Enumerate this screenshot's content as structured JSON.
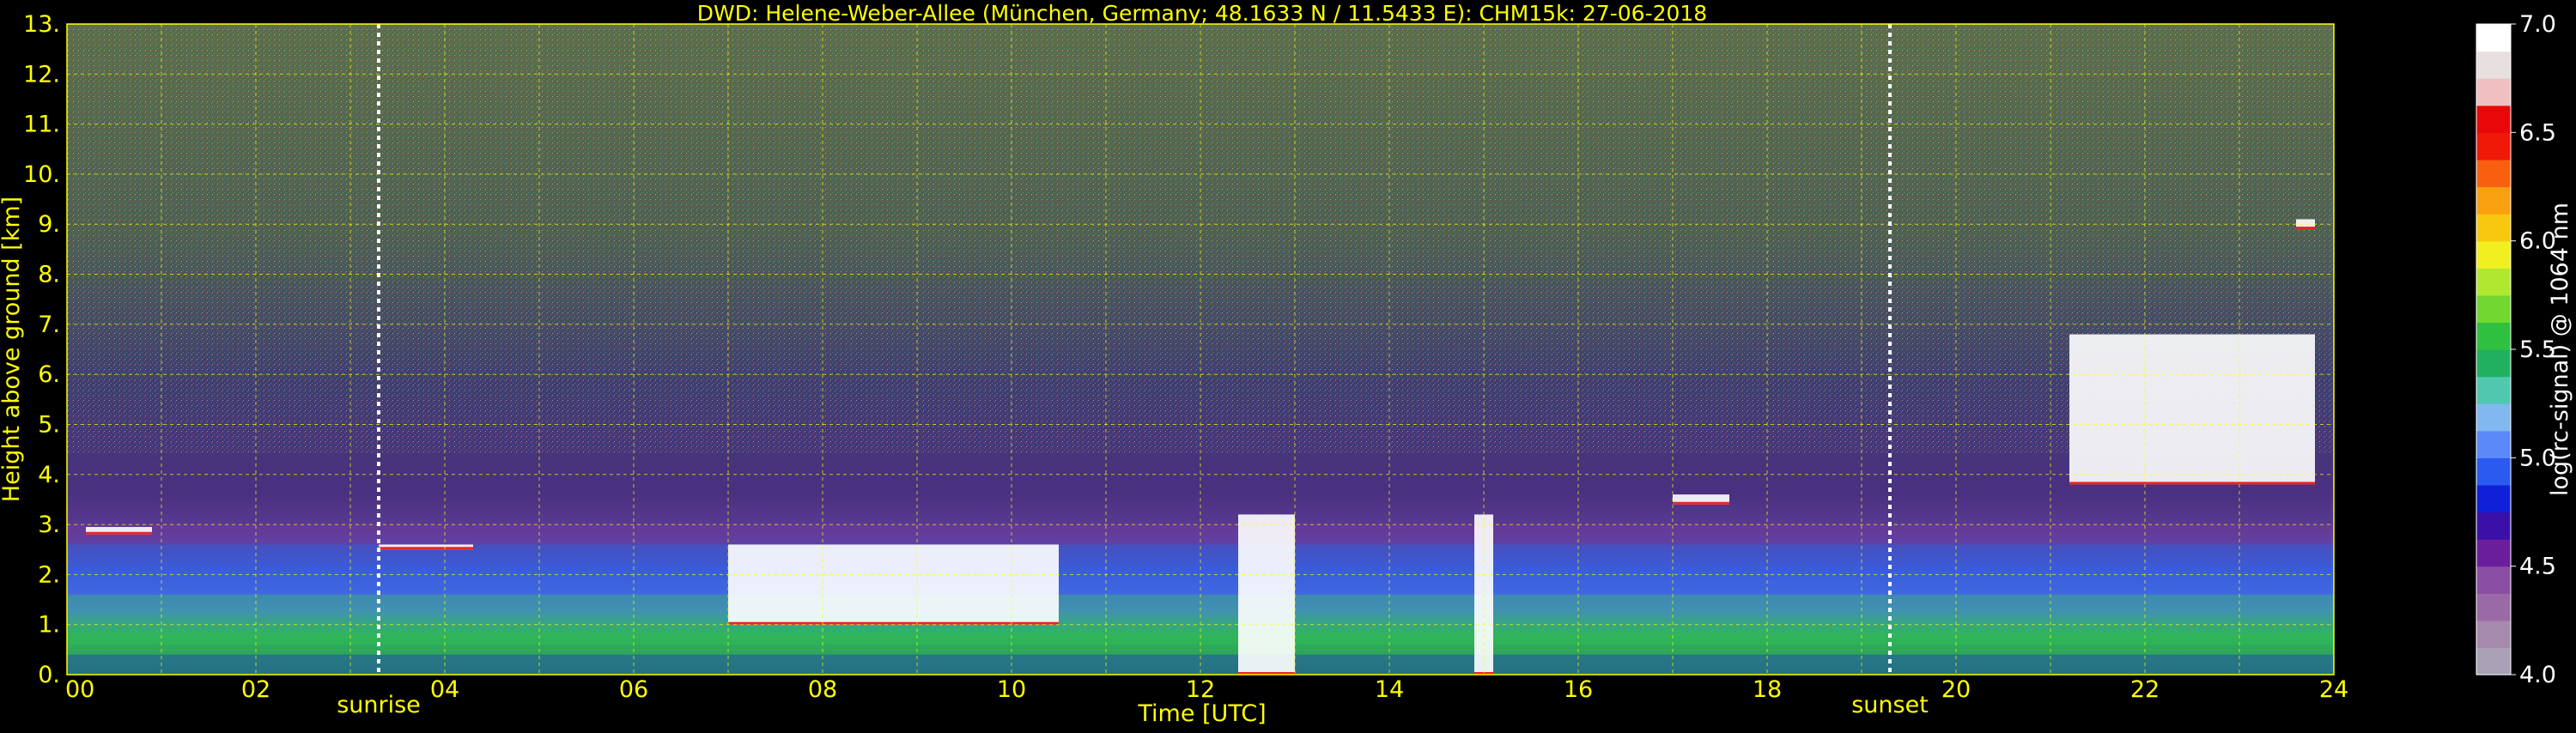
{
  "chart_data": {
    "type": "heatmap",
    "title": "DWD: Helene-Weber-Allee (München, Germany; 48.1633 N / 11.5433 E):    CHM15k: 27-06-2018",
    "xlabel": "Time [UTC]",
    "ylabel": "Height above ground [km]",
    "xlim": [
      0,
      24
    ],
    "ylim": [
      0,
      13
    ],
    "x_ticks": [
      "00",
      "02",
      "04",
      "06",
      "08",
      "10",
      "12",
      "14",
      "16",
      "18",
      "20",
      "22",
      "24"
    ],
    "y_ticks": [
      "0.",
      "1.",
      "2.",
      "3.",
      "4.",
      "5.",
      "6.",
      "7.",
      "8.",
      "9.",
      "10.",
      "11.",
      "12.",
      "13."
    ],
    "grid": true,
    "markers": [
      {
        "label": "sunrise",
        "time": 3.3
      },
      {
        "label": "sunset",
        "time": 19.3
      }
    ],
    "colorbar": {
      "label": "log(rc-signal) @ 1064 nm",
      "range": [
        4.0,
        7.0
      ],
      "ticks": [
        "4.0",
        "4.5",
        "5.0",
        "5.5",
        "6.0",
        "6.5",
        "7.0"
      ],
      "colors": [
        "#a8a0b4",
        "#a68aac",
        "#9a6aa6",
        "#8a4ea4",
        "#6a1e9c",
        "#3a10a8",
        "#1020d8",
        "#2a5af0",
        "#5a8af8",
        "#80b8f0",
        "#50c8b0",
        "#20b060",
        "#30c040",
        "#70d830",
        "#b0e830",
        "#f0f020",
        "#f8c810",
        "#f8a010",
        "#f86010",
        "#f01808",
        "#e80808",
        "#f0c0c0",
        "#e8e0e0",
        "#ffffff"
      ]
    },
    "background_layers": [
      {
        "name": "upper noise",
        "color": "#556a50"
      },
      {
        "name": "molecular",
        "color": "#4a3c78"
      },
      {
        "name": "aerosol layer",
        "color": "#3a5ad0"
      },
      {
        "name": "boundary layer",
        "color": "#30b050"
      }
    ],
    "cloud_layers": [
      {
        "time_start": 0.2,
        "time_end": 0.9,
        "base_km": 2.8,
        "top_km": 2.95
      },
      {
        "time_start": 3.3,
        "time_end": 4.3,
        "base_km": 2.5,
        "top_km": 2.6
      },
      {
        "time_start": 7.0,
        "time_end": 10.5,
        "base_km": 1.0,
        "top_km": 2.6
      },
      {
        "time_start": 12.4,
        "time_end": 13.0,
        "base_km": 0.0,
        "top_km": 3.2
      },
      {
        "time_start": 14.9,
        "time_end": 15.1,
        "base_km": 0.0,
        "top_km": 3.2
      },
      {
        "time_start": 17.0,
        "time_end": 17.6,
        "base_km": 3.4,
        "top_km": 3.6
      },
      {
        "time_start": 21.2,
        "time_end": 23.8,
        "base_km": 3.8,
        "top_km": 6.8
      },
      {
        "time_start": 23.6,
        "time_end": 23.8,
        "base_km": 8.9,
        "top_km": 9.1
      }
    ]
  }
}
